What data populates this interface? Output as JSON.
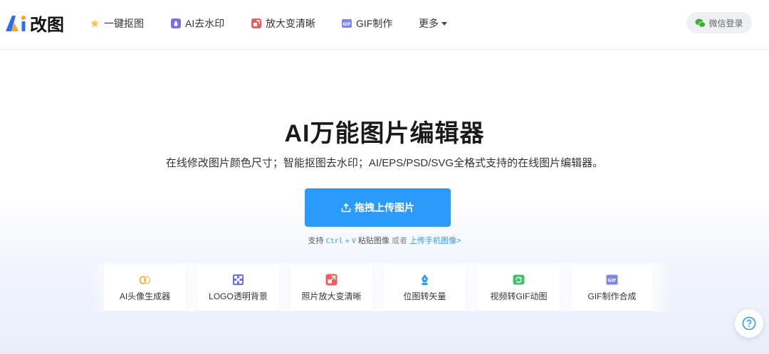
{
  "header": {
    "logo_text": "改图",
    "nav": [
      {
        "label": "一键抠图",
        "icon": "magic-wand-icon"
      },
      {
        "label": "AI去水印",
        "icon": "water-drop-icon"
      },
      {
        "label": "放大变清晰",
        "icon": "enlarge-icon"
      },
      {
        "label": "GIF制作",
        "icon": "gif-icon"
      },
      {
        "label": "更多",
        "icon": "caret-down-icon"
      }
    ],
    "login_label": "微信登录"
  },
  "hero": {
    "title": "AI万能图片编辑器",
    "subtitle": "在线修改图片颜色尺寸；智能抠图去水印；AI/EPS/PSD/SVG全格式支持的在线图片编辑器。",
    "upload_label": "拖拽上传图片",
    "hint_prefix": "支持",
    "hint_ctrl": "Ctrl",
    "hint_plus": "+",
    "hint_v": "V",
    "hint_paste": "粘贴图像",
    "hint_or": "或者",
    "hint_link": "上传手机图像>"
  },
  "tools": [
    {
      "label": "AI头像生成器",
      "icon": "avatar-generator-icon",
      "color": "#f5a623"
    },
    {
      "label": "LOGO透明背景",
      "icon": "transparent-grid-icon",
      "color": "#6b6fe8"
    },
    {
      "label": "照片放大变清晰",
      "icon": "enlarge-icon",
      "color": "#f45b5b"
    },
    {
      "label": "位图转矢量",
      "icon": "pen-tool-icon",
      "color": "#2b9bfb"
    },
    {
      "label": "视频转GIF动图",
      "icon": "video-refresh-icon",
      "color": "#3cc36b"
    },
    {
      "label": "GIF制作合成",
      "icon": "gif-icon",
      "color": "#7b88e8"
    }
  ],
  "colors": {
    "accent": "#2b9bfb",
    "nav_text": "#333333"
  }
}
